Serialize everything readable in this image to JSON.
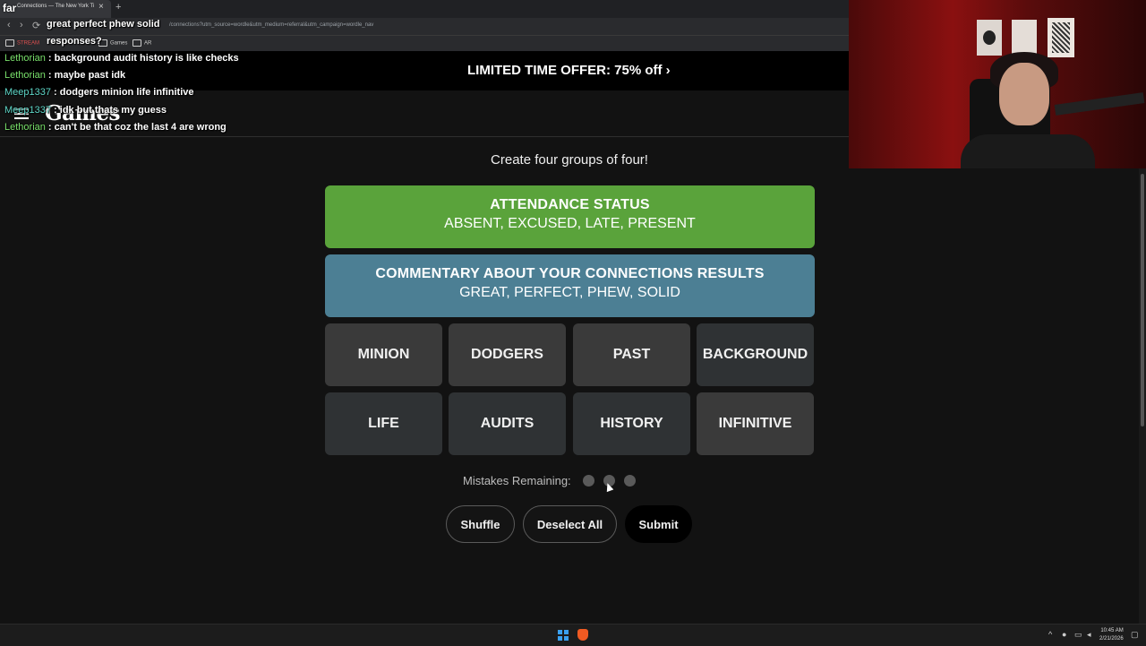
{
  "browser": {
    "tab_title": "Connections — The New York Ti",
    "tab_close": "×",
    "new_tab": "+",
    "url": "/connections?utm_source=wordle&utm_medium=referral&utm_campaign=wordle_nav",
    "nav_back": "‹",
    "nav_forward": "›",
    "nav_reload": "⟳",
    "bookmarks": [
      "STREAM",
      "Games",
      "AR"
    ]
  },
  "overlay": {
    "top_word": "far",
    "line1": "great perfect phew solid",
    "line2": "responses?"
  },
  "chat": [
    {
      "user": "Lethorian",
      "message": "background audit history is like checks",
      "color": "green"
    },
    {
      "user": "Lethorian",
      "message": "maybe past idk",
      "color": "green"
    },
    {
      "user": "Meep1337",
      "message": "dodgers minion life infinitive",
      "color": "teal"
    },
    {
      "user": "Meep1337",
      "message": "idk but thats my guess",
      "color": "teal"
    },
    {
      "user": "Lethorian",
      "message": "can't be that coz the last 4 are wrong",
      "color": "green"
    }
  ],
  "banner": {
    "text": "LIMITED TIME OFFER:  75% off ›"
  },
  "site": {
    "logo": "Games"
  },
  "game": {
    "subtitle": "Create four groups of four!",
    "solved_groups": [
      {
        "title": "ATTENDANCE STATUS",
        "words": "ABSENT, EXCUSED, LATE, PRESENT",
        "color": "#5aa33b"
      },
      {
        "title": "COMMENTARY ABOUT YOUR CONNECTIONS RESULTS",
        "words": "GREAT, PERFECT, PHEW, SOLID",
        "color": "#4c7f94"
      }
    ],
    "tiles": [
      "MINION",
      "DODGERS",
      "PAST",
      "BACKGROUND",
      "LIFE",
      "AUDITS",
      "HISTORY",
      "INFINITIVE"
    ],
    "mistakes_label": "Mistakes Remaining:",
    "mistakes_remaining": 3,
    "buttons": {
      "shuffle": "Shuffle",
      "deselect": "Deselect All",
      "submit": "Submit"
    }
  },
  "taskbar": {
    "time": "10:45 AM",
    "date": "2/21/2026"
  }
}
